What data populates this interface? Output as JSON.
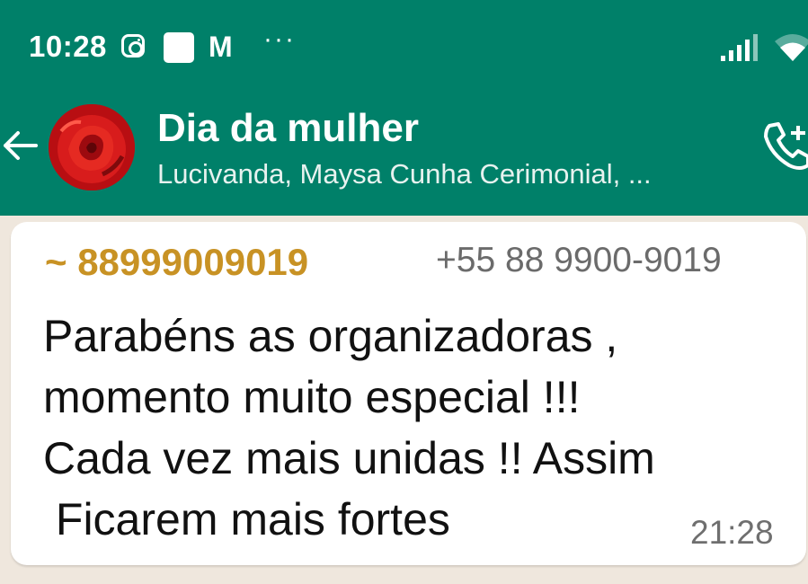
{
  "status_bar": {
    "time": "10:28",
    "icons": [
      "instagram-icon",
      "notification-square-icon",
      "gmail-icon",
      "more-dots-icon",
      "signal-icon",
      "wifi-icon"
    ]
  },
  "header": {
    "title": "Dia da mulher",
    "subtitle": "Lucivanda, Maysa Cunha Cerimonial, ...",
    "back_icon": "arrow-back-icon",
    "call_icon": "add-call-icon",
    "avatar": "red-rose-group-avatar"
  },
  "message": {
    "sender_name": "~ 88999009019",
    "sender_phone": "+55 88 9900-9019",
    "text": "Parabéns as organizadoras ,\nmomento muito especial !!!\nCada vez mais unidas !! Assim\n Ficarem mais fortes",
    "time": "21:28"
  },
  "colors": {
    "header_bg": "#008069",
    "chat_bg": "#efe7dd",
    "sender_name": "#c89224",
    "bubble_bg": "#ffffff"
  }
}
